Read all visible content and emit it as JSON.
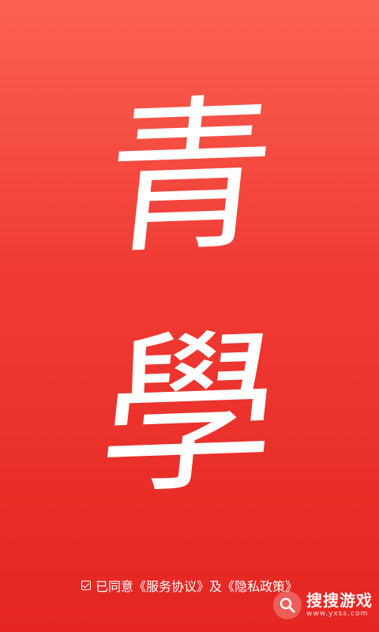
{
  "logo": {
    "char1": "青",
    "char2": "學"
  },
  "agreement": {
    "prefix": "已同意",
    "service_link": "《服务协议》",
    "connector": "及",
    "privacy_link": "《隐私政策》"
  },
  "watermark": {
    "title": "搜搜游戏",
    "url": "www.yxss.com"
  },
  "colors": {
    "background_top": "#fb6152",
    "background_bottom": "#e52622",
    "foreground": "#ffffff"
  }
}
